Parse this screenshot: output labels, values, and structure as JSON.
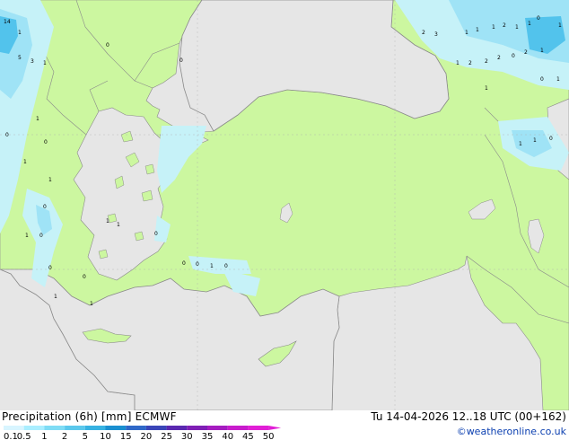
{
  "header": {
    "title": "Precipitation (6h) [mm] ECMWF",
    "valid_time": "Tu 14-04-2026 12..18 UTC (00+162)",
    "credit": "©weatheronline.co.uk"
  },
  "scale": {
    "labels": [
      "0.1",
      "0.5",
      "1",
      "2",
      "5",
      "10",
      "15",
      "20",
      "25",
      "30",
      "35",
      "40",
      "45",
      "50"
    ],
    "colors": [
      "#d8f5ff",
      "#aaeeff",
      "#7fdcf5",
      "#5bc8ec",
      "#37b2e2",
      "#1a8fd0",
      "#2f68c8",
      "#3a45b8",
      "#5a28b0",
      "#7f1fb5",
      "#a51cc0",
      "#c81ccc",
      "#e11fd6"
    ]
  },
  "colors": {
    "sea": "#e6e6e6",
    "land": "#ccf7a0",
    "precip_light": "#c6f2f8",
    "precip_medium": "#9fe3f6",
    "precip_heavy": "#52c3ec",
    "border": "#8a8a8a"
  },
  "map_values": [
    "14",
    "1",
    "5",
    "3",
    "1",
    "1",
    "0",
    "1",
    "1",
    "0",
    "0",
    "1",
    "0",
    "0",
    "0",
    "1",
    "1",
    "1",
    "0",
    "0",
    "0",
    "1",
    "0",
    "0",
    "2",
    "3",
    "1",
    "1",
    "1",
    "2",
    "1",
    "1",
    "0",
    "1",
    "2",
    "2",
    "2",
    "0",
    "2",
    "1",
    "0",
    "1",
    "0",
    "1",
    "1",
    "1",
    "0",
    "1",
    "1"
  ]
}
